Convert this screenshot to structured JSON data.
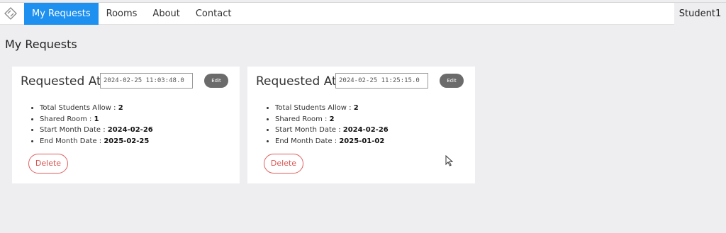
{
  "nav": {
    "logo_icon": "diamond-logo-icon",
    "items": [
      {
        "label": "My Requests",
        "active": true
      },
      {
        "label": "Rooms",
        "active": false
      },
      {
        "label": "About",
        "active": false
      },
      {
        "label": "Contact",
        "active": false
      }
    ],
    "user": "Student1"
  },
  "page": {
    "title": "My Requests"
  },
  "requests": [
    {
      "requested_label": "Requested At :",
      "requested_at": "2024-02-25 11:03:48.0",
      "edit_label": "Edit",
      "details": [
        {
          "label": "Total Students Allow : ",
          "value": "2"
        },
        {
          "label": "Shared Room : ",
          "value": "1"
        },
        {
          "label": "Start Month Date : ",
          "value": "2024-02-26"
        },
        {
          "label": "End Month Date : ",
          "value": "2025-02-25"
        }
      ],
      "delete_label": "Delete"
    },
    {
      "requested_label": "Requested At :",
      "requested_at": "2024-02-25 11:25:15.0",
      "edit_label": "Edit",
      "details": [
        {
          "label": "Total Students Allow : ",
          "value": "2"
        },
        {
          "label": "Shared Room : ",
          "value": "2"
        },
        {
          "label": "Start Month Date : ",
          "value": "2024-02-26"
        },
        {
          "label": "End Month Date : ",
          "value": "2025-01-02"
        }
      ],
      "delete_label": "Delete"
    }
  ],
  "colors": {
    "active_nav": "#1e90f0",
    "edit_button": "#6b6b6b",
    "delete_border": "#e06060",
    "page_background": "#eeedf0"
  }
}
